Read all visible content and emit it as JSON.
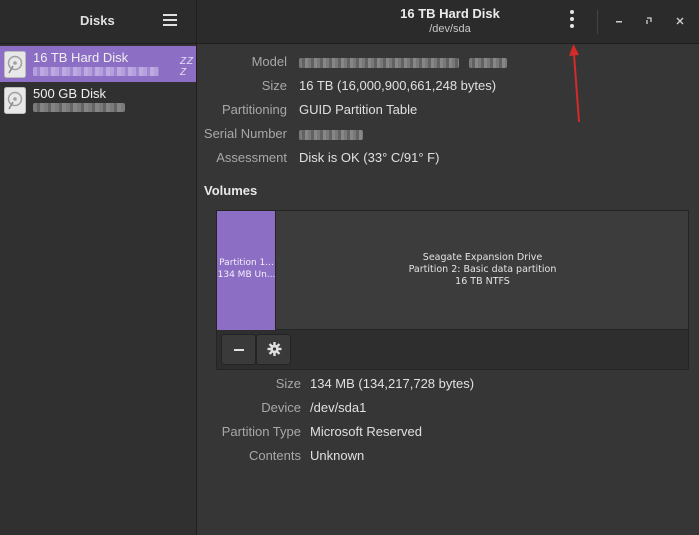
{
  "app": {
    "title": "Disks",
    "menu_icon": "hamburger-menu-icon"
  },
  "header": {
    "title": "16 TB Hard Disk",
    "subtitle": "/dev/sda",
    "drive_menu_icon": "kebab-menu-icon",
    "window_controls": [
      "minimize-icon",
      "restore-icon",
      "close-icon"
    ]
  },
  "sidebar": {
    "items": [
      {
        "name": "16 TB Hard Disk",
        "selected": true,
        "standby_indicator": "Z Z Z",
        "icon": "drive-icon"
      },
      {
        "name": "500 GB Disk",
        "selected": false,
        "icon": "drive-icon"
      }
    ]
  },
  "drive": {
    "model_label": "Model",
    "size_label": "Size",
    "size_value": "16 TB (16,000,900,661,248 bytes)",
    "partitioning_label": "Partitioning",
    "partitioning_value": "GUID Partition Table",
    "serial_label": "Serial Number",
    "assessment_label": "Assessment",
    "assessment_value": "Disk is OK (33° C/91° F)"
  },
  "volumes": {
    "heading": "Volumes",
    "partitions": [
      {
        "line1": "Partition 1...",
        "line2": "134 MB Un...",
        "selected": true
      },
      {
        "line1": "Seagate Expansion Drive",
        "line2": "Partition 2: Basic data partition",
        "line3": "16 TB NTFS",
        "selected": false
      }
    ],
    "toolbar": [
      "minus-icon",
      "gear-icon"
    ]
  },
  "partition": {
    "size_label": "Size",
    "size_value": "134 MB (134,217,728 bytes)",
    "device_label": "Device",
    "device_value": "/dev/sda1",
    "type_label": "Partition Type",
    "type_value": "Microsoft Reserved",
    "contents_label": "Contents",
    "contents_value": "Unknown"
  },
  "colors": {
    "accent": "#8c6ec5",
    "annotation_arrow": "#d42a2a",
    "background": "#363636"
  }
}
